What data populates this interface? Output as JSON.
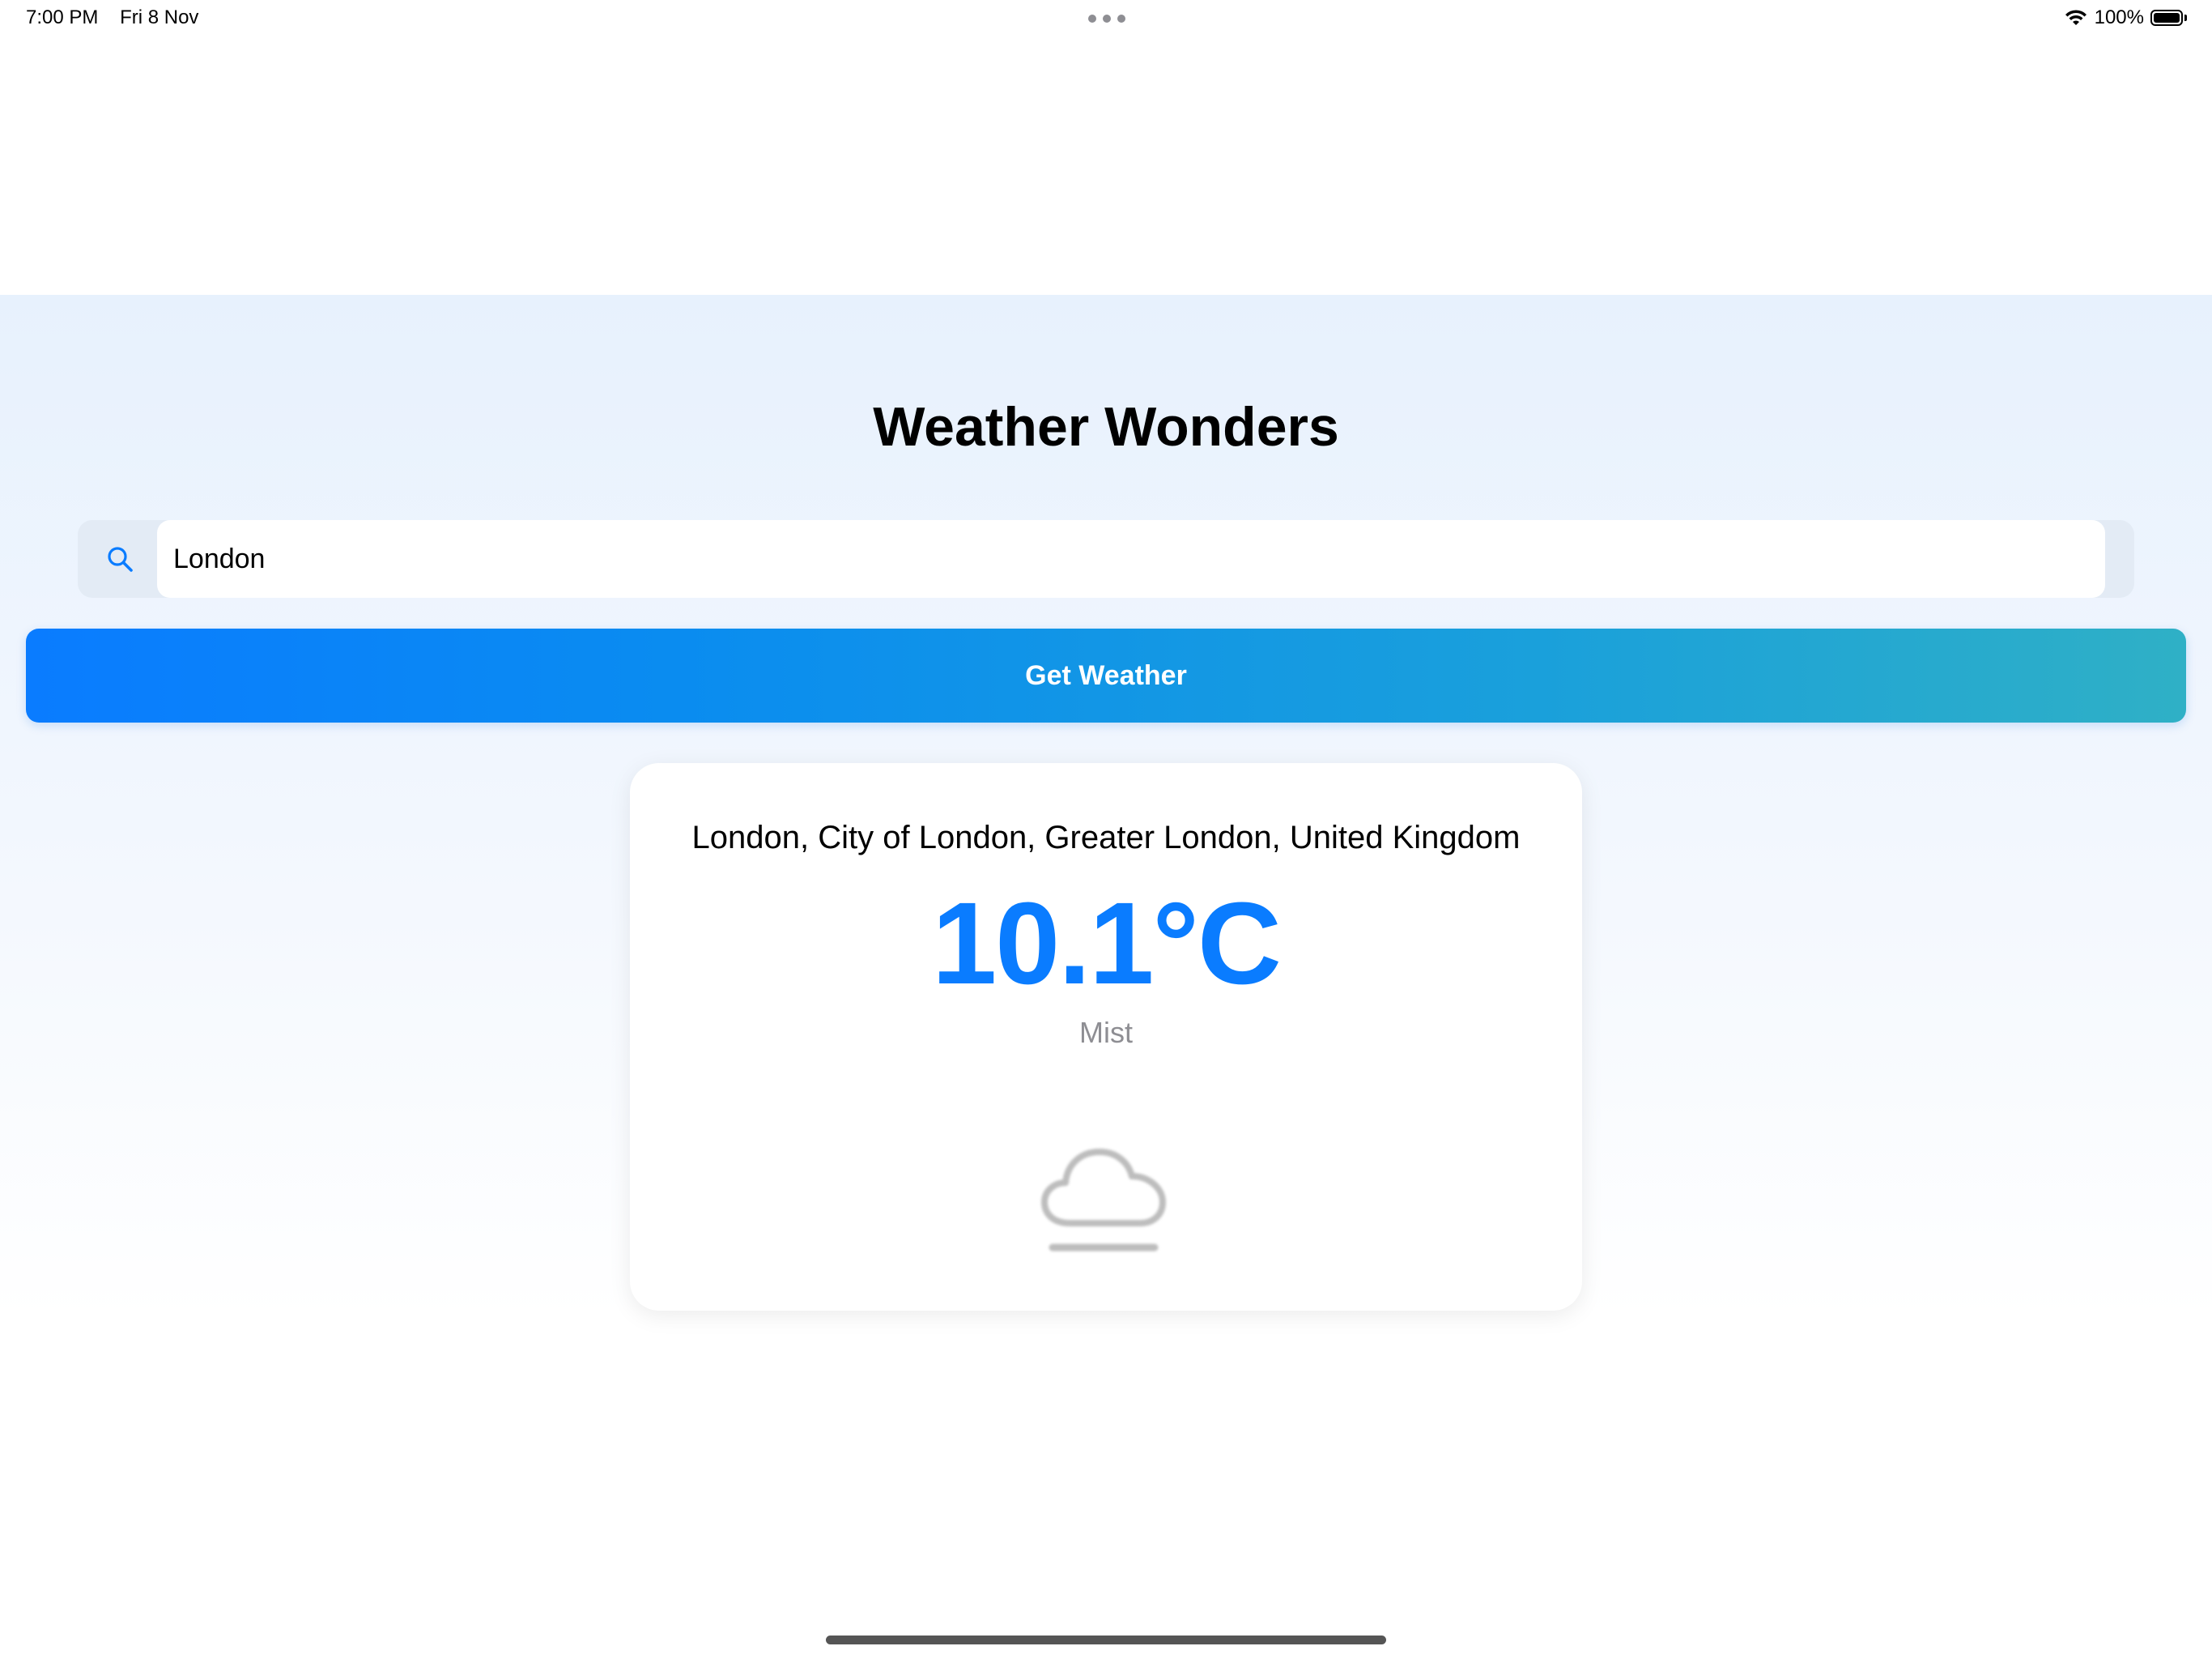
{
  "status_bar": {
    "time": "7:00 PM",
    "date": "Fri 8 Nov",
    "battery": "100%",
    "wifi_icon": "wifi-icon",
    "battery_icon": "battery-icon"
  },
  "app": {
    "title": "Weather Wonders"
  },
  "search": {
    "value": "London",
    "icon": "search-icon"
  },
  "button": {
    "label": "Get Weather"
  },
  "weather": {
    "location": "London, City of London, Greater London, United Kingdom",
    "temperature": "10.1°C",
    "condition": "Mist",
    "icon": "mist-icon"
  },
  "colors": {
    "accent": "#0a7cff",
    "button_gradient_start": "#0a7cff",
    "button_gradient_end": "#2fb0c6",
    "condition_text": "#8e8e93"
  }
}
